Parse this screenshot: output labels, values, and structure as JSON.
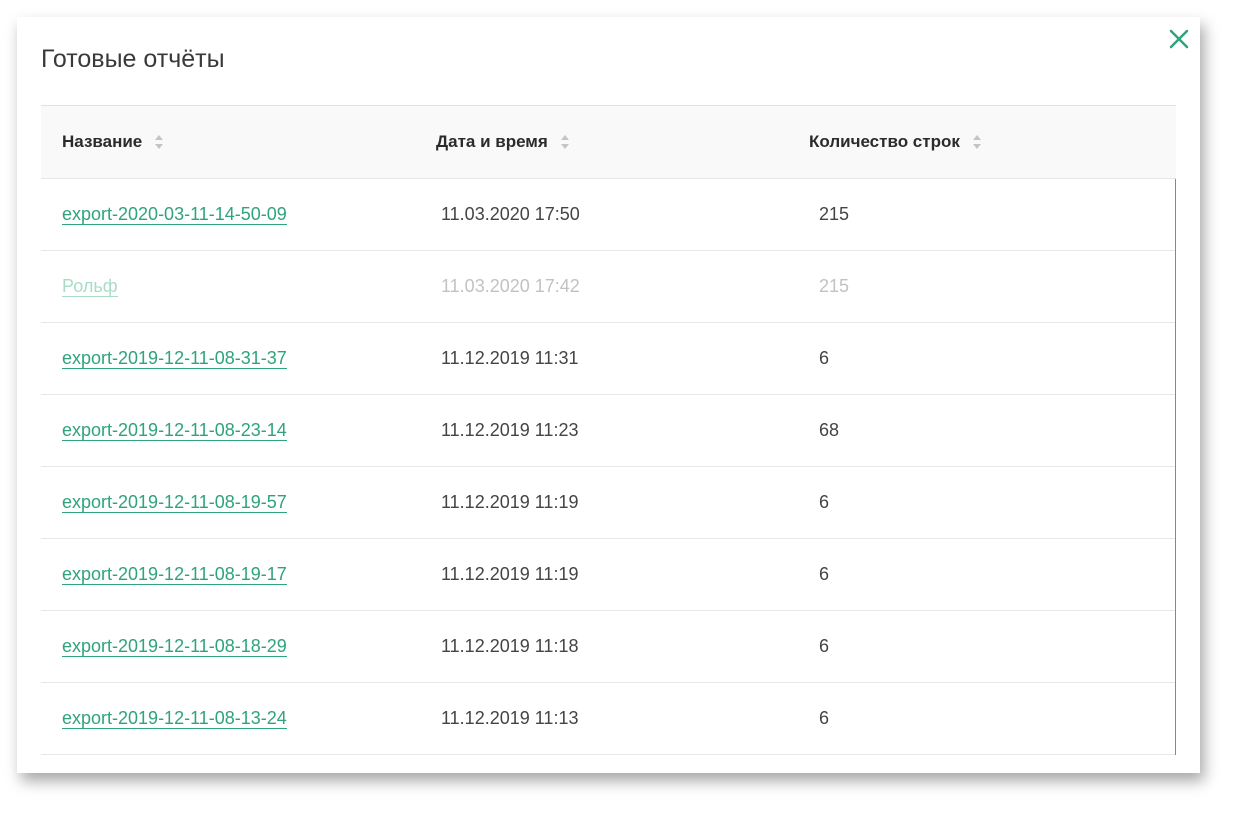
{
  "dialog": {
    "title": "Готовые отчёты",
    "close_icon": "close-icon",
    "accent_color": "#2fa37b"
  },
  "table": {
    "columns": [
      {
        "label": "Название",
        "sort_icon": "sort-icon"
      },
      {
        "label": "Дата и время",
        "sort_icon": "sort-icon"
      },
      {
        "label": "Количество строк",
        "sort_icon": "sort-icon"
      }
    ],
    "rows": [
      {
        "name": "export-2020-03-11-14-50-09",
        "datetime": "11.03.2020 17:50",
        "rows": "215",
        "dimmed": false
      },
      {
        "name": "Рольф",
        "datetime": "11.03.2020 17:42",
        "rows": "215",
        "dimmed": true
      },
      {
        "name": "export-2019-12-11-08-31-37",
        "datetime": "11.12.2019 11:31",
        "rows": "6",
        "dimmed": false
      },
      {
        "name": "export-2019-12-11-08-23-14",
        "datetime": "11.12.2019 11:23",
        "rows": "68",
        "dimmed": false
      },
      {
        "name": "export-2019-12-11-08-19-57",
        "datetime": "11.12.2019 11:19",
        "rows": "6",
        "dimmed": false
      },
      {
        "name": "export-2019-12-11-08-19-17",
        "datetime": "11.12.2019 11:19",
        "rows": "6",
        "dimmed": false
      },
      {
        "name": "export-2019-12-11-08-18-29",
        "datetime": "11.12.2019 11:18",
        "rows": "6",
        "dimmed": false
      },
      {
        "name": "export-2019-12-11-08-13-24",
        "datetime": "11.12.2019 11:13",
        "rows": "6",
        "dimmed": false
      }
    ]
  }
}
